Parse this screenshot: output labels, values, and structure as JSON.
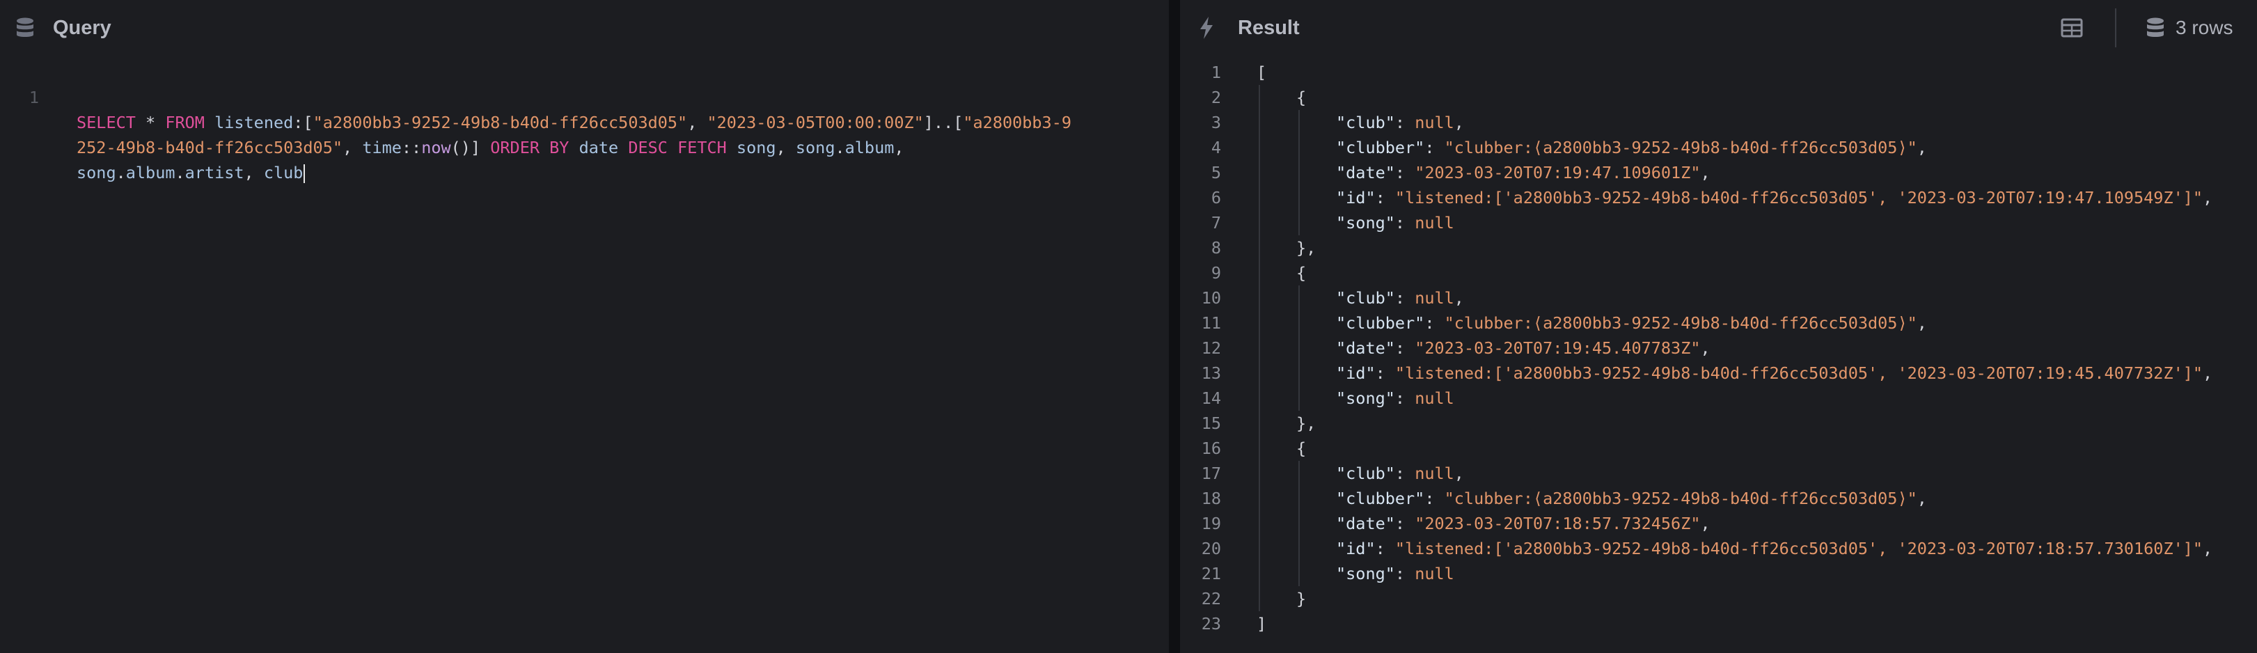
{
  "query_panel": {
    "title": "Query",
    "icon": "database-icon",
    "line_number": "1",
    "lines": [
      [
        {
          "t": "kw",
          "v": "SELECT"
        },
        {
          "t": "op",
          "v": " * "
        },
        {
          "t": "kw",
          "v": "FROM"
        },
        {
          "t": "op",
          "v": " "
        },
        {
          "t": "id",
          "v": "listened"
        },
        {
          "t": "op",
          "v": ":["
        },
        {
          "t": "str",
          "v": "\"a2800bb3-9252-49b8-b40d-ff26cc503d05\""
        },
        {
          "t": "op",
          "v": ", "
        },
        {
          "t": "str",
          "v": "\"2023-03-05T00:00:00Z\""
        },
        {
          "t": "op",
          "v": "]..["
        },
        {
          "t": "str",
          "v": "\"a2800bb3-9"
        }
      ],
      [
        {
          "t": "str",
          "v": "252-49b8-b40d-ff26cc503d05\""
        },
        {
          "t": "op",
          "v": ", "
        },
        {
          "t": "id",
          "v": "time"
        },
        {
          "t": "op",
          "v": "::"
        },
        {
          "t": "fn",
          "v": "now"
        },
        {
          "t": "op",
          "v": "()] "
        },
        {
          "t": "kw",
          "v": "ORDER BY"
        },
        {
          "t": "op",
          "v": " "
        },
        {
          "t": "id",
          "v": "date"
        },
        {
          "t": "op",
          "v": " "
        },
        {
          "t": "kw",
          "v": "DESC FETCH"
        },
        {
          "t": "op",
          "v": " "
        },
        {
          "t": "id",
          "v": "song"
        },
        {
          "t": "op",
          "v": ", "
        },
        {
          "t": "id",
          "v": "song"
        },
        {
          "t": "op",
          "v": "."
        },
        {
          "t": "id",
          "v": "album"
        },
        {
          "t": "op",
          "v": ","
        }
      ],
      [
        {
          "t": "id",
          "v": "song"
        },
        {
          "t": "op",
          "v": "."
        },
        {
          "t": "id",
          "v": "album"
        },
        {
          "t": "op",
          "v": "."
        },
        {
          "t": "id",
          "v": "artist"
        },
        {
          "t": "op",
          "v": ", "
        },
        {
          "t": "id",
          "v": "club"
        }
      ]
    ]
  },
  "result_panel": {
    "title": "Result",
    "icon": "lightning-icon",
    "view_toggle_icon": "table-icon",
    "rows_icon": "database-icon",
    "rows_label": "3 rows",
    "records": [
      {
        "club": "null",
        "clubber": "\"clubber:⟨a2800bb3-9252-49b8-b40d-ff26cc503d05⟩\"",
        "date": "\"2023-03-20T07:19:47.109601Z\"",
        "id": "\"listened:['a2800bb3-9252-49b8-b40d-ff26cc503d05', '2023-03-20T07:19:47.109549Z']\"",
        "song": "null"
      },
      {
        "club": "null",
        "clubber": "\"clubber:⟨a2800bb3-9252-49b8-b40d-ff26cc503d05⟩\"",
        "date": "\"2023-03-20T07:19:45.407783Z\"",
        "id": "\"listened:['a2800bb3-9252-49b8-b40d-ff26cc503d05', '2023-03-20T07:19:45.407732Z']\"",
        "song": "null"
      },
      {
        "club": "null",
        "clubber": "\"clubber:⟨a2800bb3-9252-49b8-b40d-ff26cc503d05⟩\"",
        "date": "\"2023-03-20T07:18:57.732456Z\"",
        "id": "\"listened:['a2800bb3-9252-49b8-b40d-ff26cc503d05', '2023-03-20T07:18:57.730160Z']\"",
        "song": "null"
      }
    ]
  }
}
